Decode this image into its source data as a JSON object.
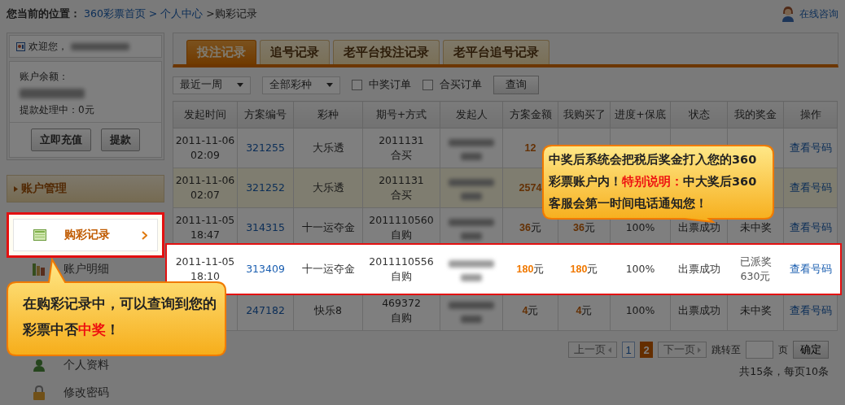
{
  "breadcrumb": {
    "label": "您当前的位置：",
    "links": [
      "360彩票首页",
      "> 个人中心"
    ],
    "current": ">购彩记录"
  },
  "help_link": "在线咨询",
  "account": {
    "welcome": "欢迎您，",
    "balance_label": "账户余额：",
    "pending": "提款处理中：0元",
    "buttons": [
      "立即充值",
      "提款"
    ]
  },
  "menu": {
    "title": "账户管理",
    "items": [
      {
        "label": "购彩记录",
        "kind": "records",
        "selected": true
      },
      {
        "label": "账户明细",
        "kind": "ledger",
        "selected": false
      },
      {
        "label": "个人资料",
        "kind": "profile",
        "selected": false
      },
      {
        "label": "修改密码",
        "kind": "password",
        "selected": false
      }
    ]
  },
  "tabs": [
    {
      "label": "投注记录",
      "selected": true
    },
    {
      "label": "追号记录",
      "selected": false
    },
    {
      "label": "老平台投注记录",
      "selected": false
    },
    {
      "label": "老平台追号记录",
      "selected": false
    }
  ],
  "filters": {
    "period": "最近一周",
    "lottery": "全部彩种",
    "checkboxes": [
      {
        "label": "中奖订单",
        "checked": false
      },
      {
        "label": "合买订单",
        "checked": false
      }
    ],
    "search_button": "查询"
  },
  "table": {
    "columns": [
      "发起时间",
      "方案编号",
      "彩种",
      "期号+方式",
      "发起人",
      "方案金额",
      "我购买了",
      "进度+保底",
      "状态",
      "我的奖金",
      "操作"
    ],
    "rows": [
      {
        "highlighted": false,
        "spotlight": false,
        "prize_paid": false,
        "cells": [
          "2011-11-06\n02:09",
          "321255",
          "大乐透",
          "2011131\n合买",
          null,
          "**12**",
          null,
          null,
          null,
          null,
          "查看号码"
        ]
      },
      {
        "highlighted": true,
        "spotlight": false,
        "prize_paid": false,
        "cells": [
          "2011-11-06\n02:07",
          "321252",
          "大乐透",
          "2011131\n合买",
          null,
          "**2574**",
          null,
          null,
          null,
          null,
          "查看号码"
        ]
      },
      {
        "highlighted": false,
        "spotlight": false,
        "prize_paid": false,
        "cells": [
          "2011-11-05\n18:47",
          "314315",
          "十一运夺金",
          "2011110560\n自购",
          null,
          "**36**元",
          "**36**元",
          "100%",
          "出票成功",
          "未中奖",
          "查看号码"
        ]
      },
      {
        "highlighted": false,
        "spotlight": true,
        "prize_paid": true,
        "cells": [
          "2011-11-05\n18:10",
          "313409",
          "十一运夺金",
          "2011110556\n自购",
          null,
          "**180**元",
          "**180**元",
          "100%",
          "出票成功",
          "已派奖\n630元",
          "查看号码"
        ]
      },
      {
        "highlighted": false,
        "spotlight": false,
        "prize_paid": false,
        "cells": [
          null,
          "247182",
          "快乐8",
          "469372\n自购",
          null,
          "**4**元",
          "**4**元",
          "100%",
          "出票成功",
          "未中奖",
          "查看号码"
        ]
      }
    ]
  },
  "pagination": {
    "prev": {
      "label": "上一页",
      "disabled": true
    },
    "pages": [
      {
        "label": "1",
        "selected": false
      },
      {
        "label": "2",
        "selected": true
      }
    ],
    "next": {
      "label": "下一页",
      "disabled": true
    },
    "jump_label": "跳转至",
    "page_unit": "页",
    "confirm": "确定",
    "summary": "共15条，每页10条"
  },
  "callouts": [
    {
      "text": "中奖后系统会把税后奖金打入您的360彩票账户内！**特别说明：**中大奖后360客服会第一时间电话通知您！"
    },
    {
      "text": "在购彩记录中，可以查询到您的彩票中否**中奖**！"
    }
  ]
}
